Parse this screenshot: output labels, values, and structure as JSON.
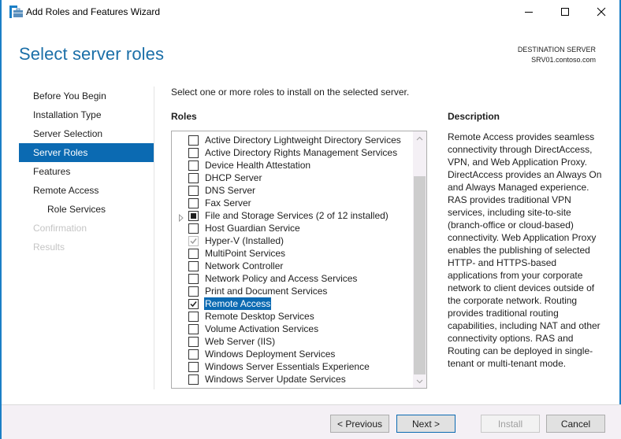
{
  "window": {
    "title": "Add Roles and Features Wizard",
    "accent_color": "#1b7fc6",
    "controls": [
      "minimize",
      "maximize",
      "close"
    ]
  },
  "header": {
    "page_title": "Select server roles",
    "destination_label": "DESTINATION SERVER",
    "destination_server": "SRV01.contoso.com"
  },
  "nav": {
    "items": [
      {
        "label": "Before You Begin",
        "state": "normal"
      },
      {
        "label": "Installation Type",
        "state": "normal"
      },
      {
        "label": "Server Selection",
        "state": "normal"
      },
      {
        "label": "Server Roles",
        "state": "active"
      },
      {
        "label": "Features",
        "state": "normal"
      },
      {
        "label": "Remote Access",
        "state": "normal"
      },
      {
        "label": "Role Services",
        "state": "sub"
      },
      {
        "label": "Confirmation",
        "state": "disabled"
      },
      {
        "label": "Results",
        "state": "disabled"
      }
    ]
  },
  "content": {
    "instruction": "Select one or more roles to install on the selected server.",
    "roles_heading": "Roles",
    "description_heading": "Description",
    "roles": [
      {
        "label": "Active Directory Lightweight Directory Services",
        "state": "unchecked"
      },
      {
        "label": "Active Directory Rights Management Services",
        "state": "unchecked"
      },
      {
        "label": "Device Health Attestation",
        "state": "unchecked"
      },
      {
        "label": "DHCP Server",
        "state": "unchecked"
      },
      {
        "label": "DNS Server",
        "state": "unchecked"
      },
      {
        "label": "Fax Server",
        "state": "unchecked"
      },
      {
        "label": "File and Storage Services (2 of 12 installed)",
        "state": "partial",
        "expandable": true
      },
      {
        "label": "Host Guardian Service",
        "state": "unchecked"
      },
      {
        "label": "Hyper-V (Installed)",
        "state": "installed"
      },
      {
        "label": "MultiPoint Services",
        "state": "unchecked"
      },
      {
        "label": "Network Controller",
        "state": "unchecked"
      },
      {
        "label": "Network Policy and Access Services",
        "state": "unchecked"
      },
      {
        "label": "Print and Document Services",
        "state": "unchecked"
      },
      {
        "label": "Remote Access",
        "state": "checked",
        "selected": true
      },
      {
        "label": "Remote Desktop Services",
        "state": "unchecked"
      },
      {
        "label": "Volume Activation Services",
        "state": "unchecked"
      },
      {
        "label": "Web Server (IIS)",
        "state": "unchecked"
      },
      {
        "label": "Windows Deployment Services",
        "state": "unchecked"
      },
      {
        "label": "Windows Server Essentials Experience",
        "state": "unchecked"
      },
      {
        "label": "Windows Server Update Services",
        "state": "unchecked"
      }
    ],
    "description": "Remote Access provides seamless connectivity through DirectAccess, VPN, and Web Application Proxy. DirectAccess provides an Always On and Always Managed experience. RAS provides traditional VPN services, including site-to-site (branch-office or cloud-based) connectivity. Web Application Proxy enables the publishing of selected HTTP- and HTTPS-based applications from your corporate network to client devices outside of the corporate network. Routing provides traditional routing capabilities, including NAT and other connectivity options. RAS and Routing can be deployed in single-tenant or multi-tenant mode."
  },
  "footer": {
    "previous_label": "< Previous",
    "next_label": "Next >",
    "install_label": "Install",
    "cancel_label": "Cancel"
  }
}
